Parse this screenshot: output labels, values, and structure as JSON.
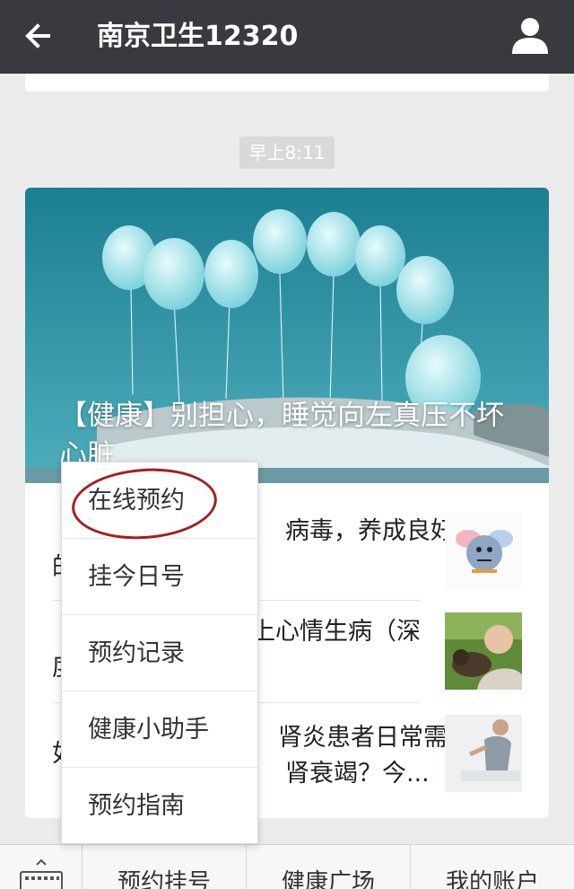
{
  "header": {
    "title": "南京卫生12320"
  },
  "timestamp": "早上8:11",
  "cover": {
    "title": "【健康】别担心，睡觉向左真压不坏心脏"
  },
  "items": [
    {
      "visible_text": [
        "的",
        "病毒，养成良好"
      ],
      "thumb": "flu-virus-cartoon"
    },
    {
      "visible_text": [
        "度",
        "上心情生病（深"
      ],
      "thumb": "smiling-man-with-dog"
    },
    {
      "visible_text": [
        "如",
        "肾炎患者日常需",
        "肾衰竭？今..."
      ],
      "thumb": "man-with-back-pain"
    }
  ],
  "menu": {
    "items": [
      "在线预约",
      "挂今日号",
      "预约记录",
      "健康小助手",
      "预约指南"
    ],
    "highlighted": "在线预约"
  },
  "bottom_tabs": [
    "预约挂号",
    "健康广场",
    "我的账户"
  ],
  "colors": {
    "header": "#393a3f",
    "annotation": "#a61e1e"
  }
}
